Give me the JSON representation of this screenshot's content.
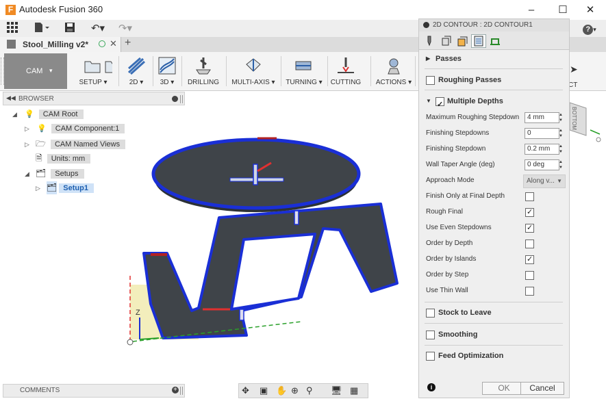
{
  "window": {
    "title": "Autodesk Fusion 360",
    "app_icon_letter": "F"
  },
  "document": {
    "tab_label": "Stool_Milling v2*"
  },
  "ribbon": {
    "workspace": "CAM",
    "groups": [
      {
        "label": "SETUP ▾"
      },
      {
        "label": "2D ▾"
      },
      {
        "label": "3D ▾"
      },
      {
        "label": "DRILLING"
      },
      {
        "label": "MULTI-AXIS ▾"
      },
      {
        "label": "TURNING ▾"
      },
      {
        "label": "CUTTING"
      },
      {
        "label": "ACTIONS ▾"
      }
    ],
    "partial_label": "CT"
  },
  "browser": {
    "title": "BROWSER",
    "items": [
      {
        "label": "CAM Root"
      },
      {
        "label": "CAM Component:1"
      },
      {
        "label": "CAM Named Views"
      },
      {
        "label": "Units: mm"
      },
      {
        "label": "Setups"
      },
      {
        "label": "Setup1"
      }
    ]
  },
  "comments": {
    "title": "COMMENTS"
  },
  "viewcube": {
    "face_label": "BOTTOM"
  },
  "axis": {
    "z_label": "Z"
  },
  "dialog": {
    "title": "2D CONTOUR : 2D CONTOUR1",
    "sections": {
      "passes": "Passes",
      "roughing": "Roughing Passes",
      "multiple_depths": "Multiple Depths",
      "stock_to_leave": "Stock to Leave",
      "smoothing": "Smoothing",
      "feed_optimization": "Feed Optimization"
    },
    "fields": {
      "max_stepdown": {
        "label": "Maximum Roughing Stepdown",
        "value": "4 mm"
      },
      "finishing_stepdowns": {
        "label": "Finishing Stepdowns",
        "value": "0"
      },
      "finishing_stepdown": {
        "label": "Finishing Stepdown",
        "value": "0.2 mm"
      },
      "wall_taper": {
        "label": "Wall Taper Angle (deg)",
        "value": "0 deg"
      },
      "approach_mode": {
        "label": "Approach Mode",
        "value": "Along v..."
      }
    },
    "checks": [
      {
        "label": "Finish Only at Final Depth",
        "checked": false
      },
      {
        "label": "Rough Final",
        "checked": true
      },
      {
        "label": "Use Even Stepdowns",
        "checked": true
      },
      {
        "label": "Order by Depth",
        "checked": false
      },
      {
        "label": "Order by Islands",
        "checked": true
      },
      {
        "label": "Order by Step",
        "checked": false
      },
      {
        "label": "Use Thin Wall",
        "checked": false
      }
    ],
    "ok": "OK",
    "cancel": "Cancel",
    "info": "i"
  }
}
